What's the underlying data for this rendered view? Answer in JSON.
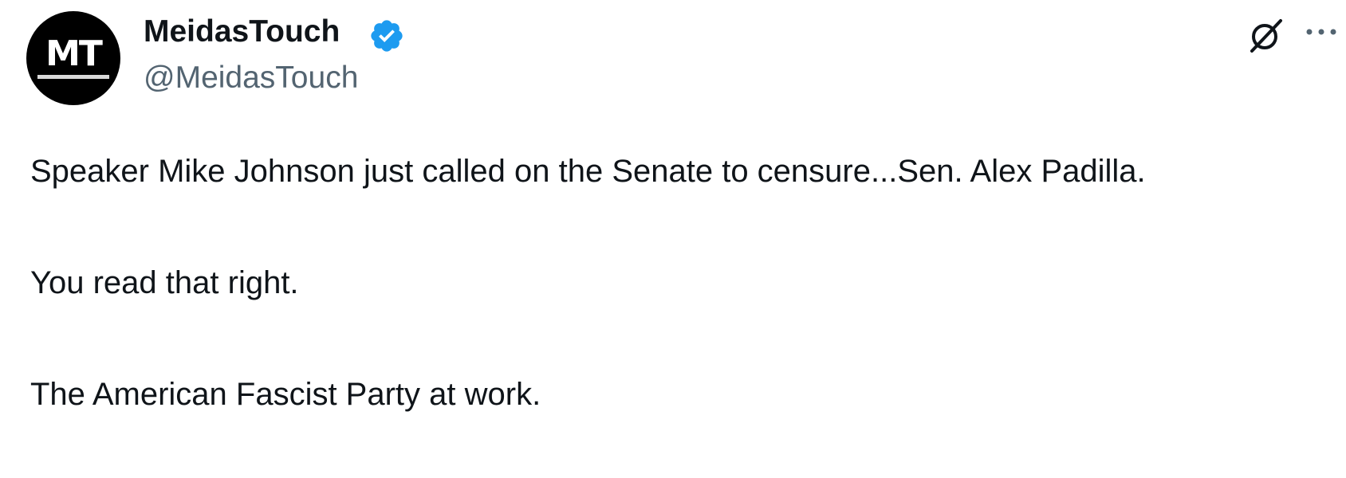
{
  "author": {
    "avatar_text": "MT",
    "display_name": "MeidasTouch",
    "handle": "@MeidasTouch",
    "verified": true,
    "verified_color": "#1d9bf0"
  },
  "icons": {
    "grok": "grok-icon",
    "more": "more-options-icon",
    "verified": "verified-badge-icon"
  },
  "tweet": {
    "text": "Speaker Mike Johnson just called on the Senate to censure...Sen. Alex Padilla.\n\nYou read that right.\n\nThe American Fascist Party at work."
  }
}
